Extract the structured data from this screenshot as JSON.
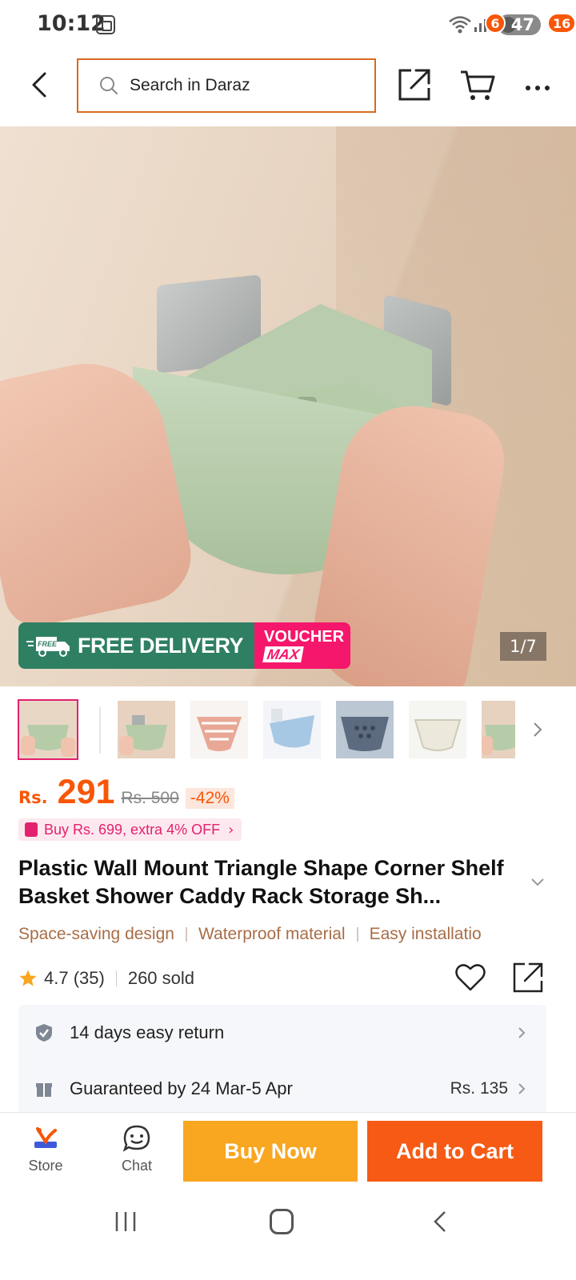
{
  "status_bar": {
    "time": "10:12",
    "battery": "47"
  },
  "header": {
    "search_placeholder": "Search in Daraz",
    "cart_count": "6",
    "more_count": "16"
  },
  "gallery": {
    "promo_free_badge": "FREE",
    "promo_free_delivery": "FREE DELIVERY",
    "promo_voucher_top": "VOUCHER",
    "promo_voucher_bottom": "MAX",
    "counter": "1/7",
    "thumbnail_count": 7
  },
  "price": {
    "currency": "Rs.",
    "value": "291",
    "original": "Rs. 500",
    "discount": "-42%"
  },
  "promotion": {
    "text": "Buy Rs. 699, extra 4% OFF"
  },
  "product": {
    "title": "Plastic Wall Mount Triangle Shape Corner Shelf Basket Shower Caddy Rack Storage Sh...",
    "features": [
      "Space-saving design",
      "Waterproof material",
      "Easy installatio"
    ]
  },
  "rating": {
    "score": "4.7 (35)",
    "sold": "260 sold"
  },
  "services": [
    {
      "text": "14 days easy return",
      "fee": ""
    },
    {
      "text": "Guaranteed by 24 Mar-5 Apr",
      "fee": "Rs. 135"
    }
  ],
  "action_bar": {
    "store_label": "Store",
    "chat_label": "Chat",
    "buy_now_label": "Buy Now",
    "add_to_cart_label": "Add to Cart"
  },
  "colors": {
    "brand_orange": "#f85606",
    "buy_now": "#f9a620",
    "promo_green": "#2f7f63",
    "voucher_pink": "#f5176b"
  }
}
